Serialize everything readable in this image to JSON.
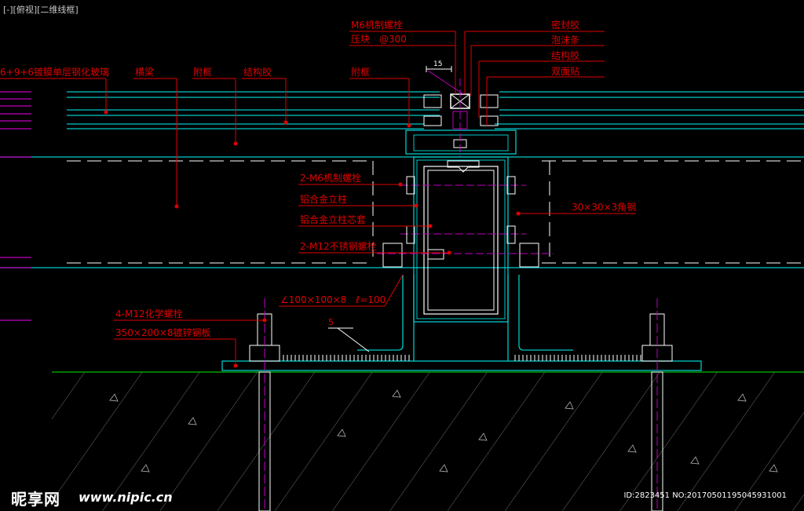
{
  "viewport_label": "[-][俯视][二维线框]",
  "labels": {
    "glass": "6+9+6镀膜单层钢化玻璃",
    "crossbeam": "横梁",
    "subframe_left": "附框",
    "struct_glue_left": "结构胶",
    "m6_bolt_top": "M6机制螺栓",
    "pressure_block": "压块　@300",
    "subframe_right": "附框",
    "sealant": "密封胶",
    "foam_strip": "泡沫条",
    "struct_glue_right": "结构胶",
    "double_tape": "双面贴",
    "dim_15": "15",
    "m6_bolt_2": "2-M6机制螺栓",
    "alu_mullion": "铝合金立柱",
    "alu_core": "铝合金立柱芯套",
    "m12_bolt": "2-M12不锈钢螺栓",
    "angle_steel": "30×30×3角钢",
    "angle_l": "∠100×100×8　ℓ=100",
    "weld_mark": "5",
    "chem_bolt": "4-M12化学螺栓",
    "plate": "350×200×8镀锌钢板"
  },
  "watermark": {
    "logo": "昵享网",
    "url": "www.nipic.cn",
    "id": "ID:2823451 NO:20170501195045931001"
  },
  "colors": {
    "background": "#000000",
    "cyan": "#00c8c8",
    "red": "#e00000",
    "white": "#ffffff",
    "magenta": "#c000c0",
    "green": "#00c000",
    "gray": "#b4b4b4"
  }
}
